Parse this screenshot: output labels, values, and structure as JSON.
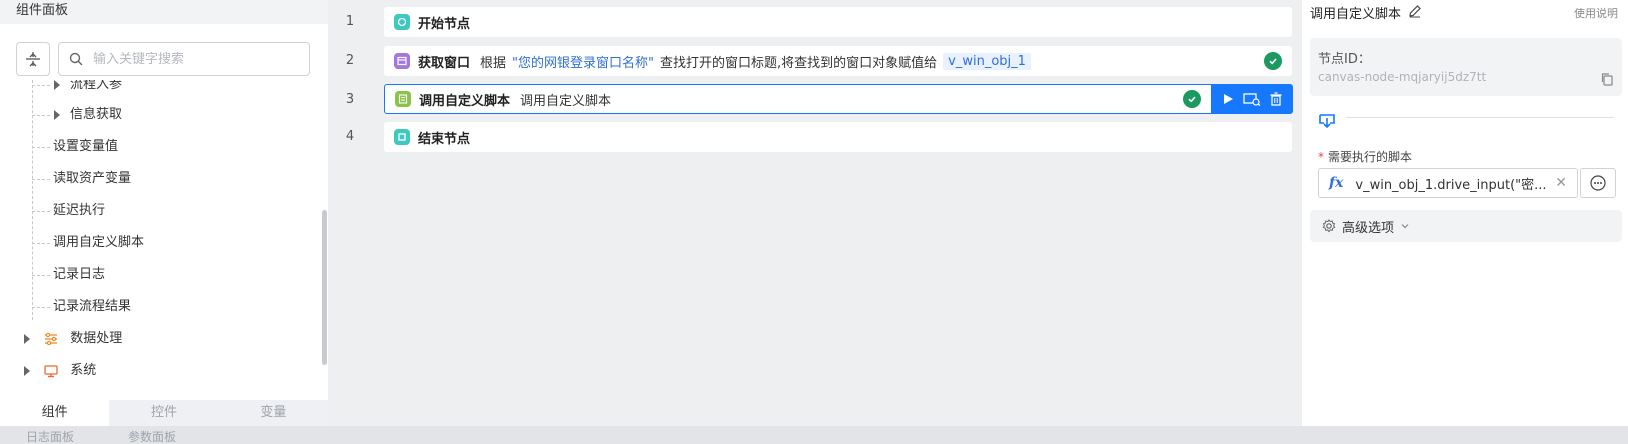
{
  "left_panel": {
    "title": "组件面板",
    "search_placeholder": "输入关键字搜索",
    "tree_items": [
      {
        "label": "流程入参"
      },
      {
        "label": "信息获取"
      },
      {
        "label": "设置变量值"
      },
      {
        "label": "读取资产变量"
      },
      {
        "label": "延迟执行"
      },
      {
        "label": "调用自定义脚本"
      },
      {
        "label": "记录日志"
      },
      {
        "label": "记录流程结果"
      }
    ],
    "categories": [
      {
        "label": "数据处理",
        "icon": "data-processing-icon",
        "color": "#f08a24"
      },
      {
        "label": "系统",
        "icon": "monitor-icon",
        "color": "#e9692c"
      }
    ],
    "tabs": [
      "组件",
      "控件",
      "变量"
    ],
    "active_tab": "组件"
  },
  "footer": {
    "tabs": [
      "日志面板",
      "参数面板"
    ]
  },
  "canvas": {
    "rows": [
      {
        "num": "1",
        "title": "开始节点",
        "icon_color": "#3ec8c0"
      },
      {
        "num": "2",
        "title": "获取窗口",
        "icon_color": "#a476e0",
        "text_before": "根据",
        "link": "\"您的网银登录窗口名称\"",
        "text_after": "查找打开的窗口标题,将查找到的窗口对象赋值给",
        "variable": "v_win_obj_1"
      },
      {
        "num": "3",
        "title": "调用自定义脚本",
        "icon_color": "#8bc34a",
        "text": "调用自定义脚本"
      },
      {
        "num": "4",
        "title": "结束节点",
        "icon_color": "#3ec8c0"
      }
    ],
    "status_color": "#1a9a60",
    "accent": "#1677ff"
  },
  "right_panel": {
    "title": "调用自定义脚本",
    "help": "使用说明",
    "node_id_label": "节点ID：",
    "node_id": "canvas-node-mqjaryij5dz7tt",
    "script_label": "需要执行的脚本",
    "required_mark": "*",
    "script_fx": "fx",
    "script_value": "v_win_obj_1.drive_input(\"密...",
    "advanced": "高级选项"
  }
}
